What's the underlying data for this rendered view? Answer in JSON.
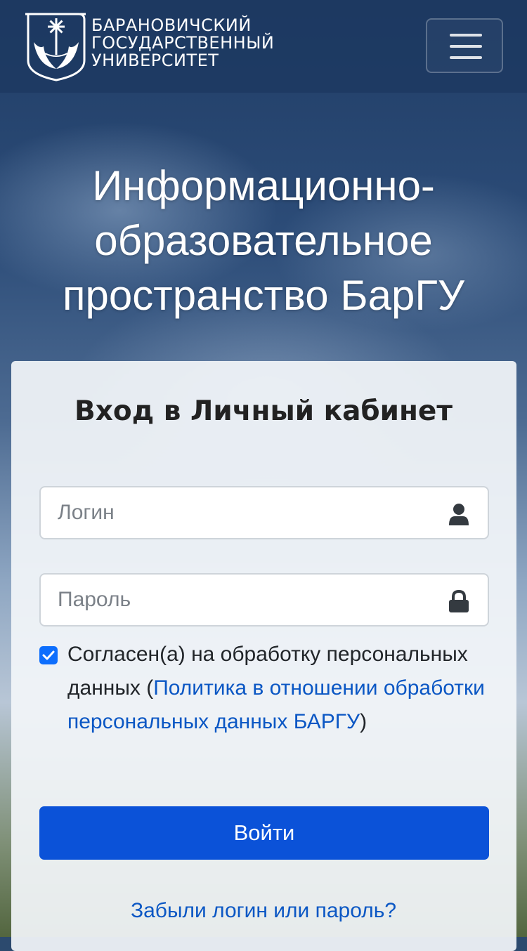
{
  "header": {
    "brand_lines": [
      "БАРАНОВИЧСКИЙ",
      "ГОСУДАРСТВЕННЫЙ",
      "УНИВЕРСИТЕТ"
    ],
    "menu_icon": "hamburger-icon"
  },
  "headline": {
    "lines": [
      "Информационно-",
      "образовательное",
      "пространство БарГУ"
    ]
  },
  "login": {
    "title": "Вход в Личный кабинет",
    "login_placeholder": "Логин",
    "login_icon": "user-icon",
    "password_placeholder": "Пароль",
    "password_icon": "lock-icon",
    "consent_checked": true,
    "consent_text": "Согласен(а) на обработку персональных данных (",
    "policy_link": "Политика в отношении обработки персональных данных БАРГУ",
    "consent_close": ")",
    "submit_label": "Войти",
    "forgot_link": "Забыли логин или пароль?"
  },
  "colors": {
    "primary": "#0b52d8",
    "link": "#0b57c4",
    "navbar": "#1c3860"
  }
}
